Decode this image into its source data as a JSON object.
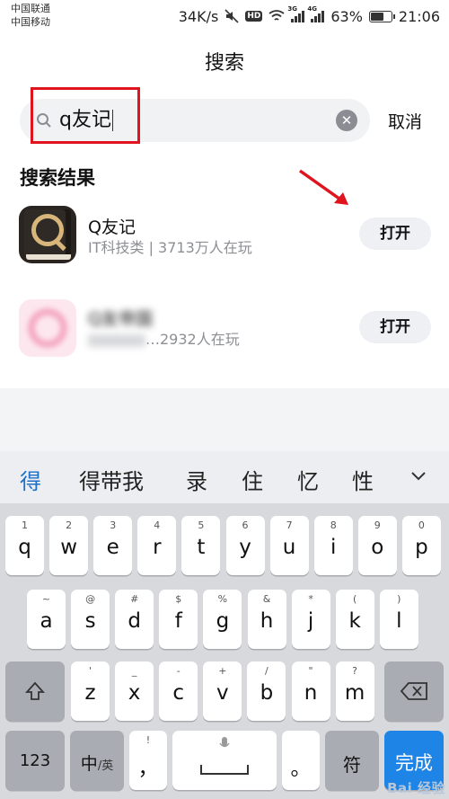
{
  "status_bar": {
    "carrier_1": "中国联通",
    "carrier_2": "中国移动",
    "speed": "34K/s",
    "hd": "HD",
    "signal_3g": "3G",
    "signal_4g": "4G",
    "battery_text": "63%",
    "battery_level": 0.63,
    "time": "21:06"
  },
  "header": {
    "title": "搜索"
  },
  "search": {
    "value": "q友记",
    "cancel_label": "取消"
  },
  "results": {
    "section_title": "搜索结果",
    "items": [
      {
        "name": "Q友记",
        "meta": "IT科技类 | 3713万人在玩",
        "button": "打开"
      },
      {
        "name": "Q友帝国",
        "meta": "…2932人在玩",
        "button": "打开"
      }
    ]
  },
  "candidates": [
    "得",
    "得带我",
    "录",
    "住",
    "忆",
    "性"
  ],
  "keyboard": {
    "row1": [
      {
        "hint": "1",
        "key": "q"
      },
      {
        "hint": "2",
        "key": "w"
      },
      {
        "hint": "3",
        "key": "e"
      },
      {
        "hint": "4",
        "key": "r"
      },
      {
        "hint": "5",
        "key": "t"
      },
      {
        "hint": "6",
        "key": "y"
      },
      {
        "hint": "7",
        "key": "u"
      },
      {
        "hint": "8",
        "key": "i"
      },
      {
        "hint": "9",
        "key": "o"
      },
      {
        "hint": "0",
        "key": "p"
      }
    ],
    "row2": [
      {
        "hint": "~",
        "key": "a"
      },
      {
        "hint": "@",
        "key": "s"
      },
      {
        "hint": "#",
        "key": "d"
      },
      {
        "hint": "$",
        "key": "f"
      },
      {
        "hint": "%",
        "key": "g"
      },
      {
        "hint": "&",
        "key": "h"
      },
      {
        "hint": "*",
        "key": "j"
      },
      {
        "hint": "(",
        "key": "k"
      },
      {
        "hint": ")",
        "key": "l"
      }
    ],
    "row3": [
      {
        "hint": "'",
        "key": "z"
      },
      {
        "hint": "_",
        "key": "x"
      },
      {
        "hint": "-",
        "key": "c"
      },
      {
        "hint": "+",
        "key": "v"
      },
      {
        "hint": "/",
        "key": "b"
      },
      {
        "hint": "\"",
        "key": "n"
      },
      {
        "hint": "?",
        "key": "m"
      }
    ],
    "num_label": "123",
    "lang_label": "中",
    "lang_sub": "/英",
    "punct_hint": "!",
    "punct_label": "，",
    "sym_label": "符",
    "done_label": "完成"
  },
  "watermark": "Bai 经验"
}
